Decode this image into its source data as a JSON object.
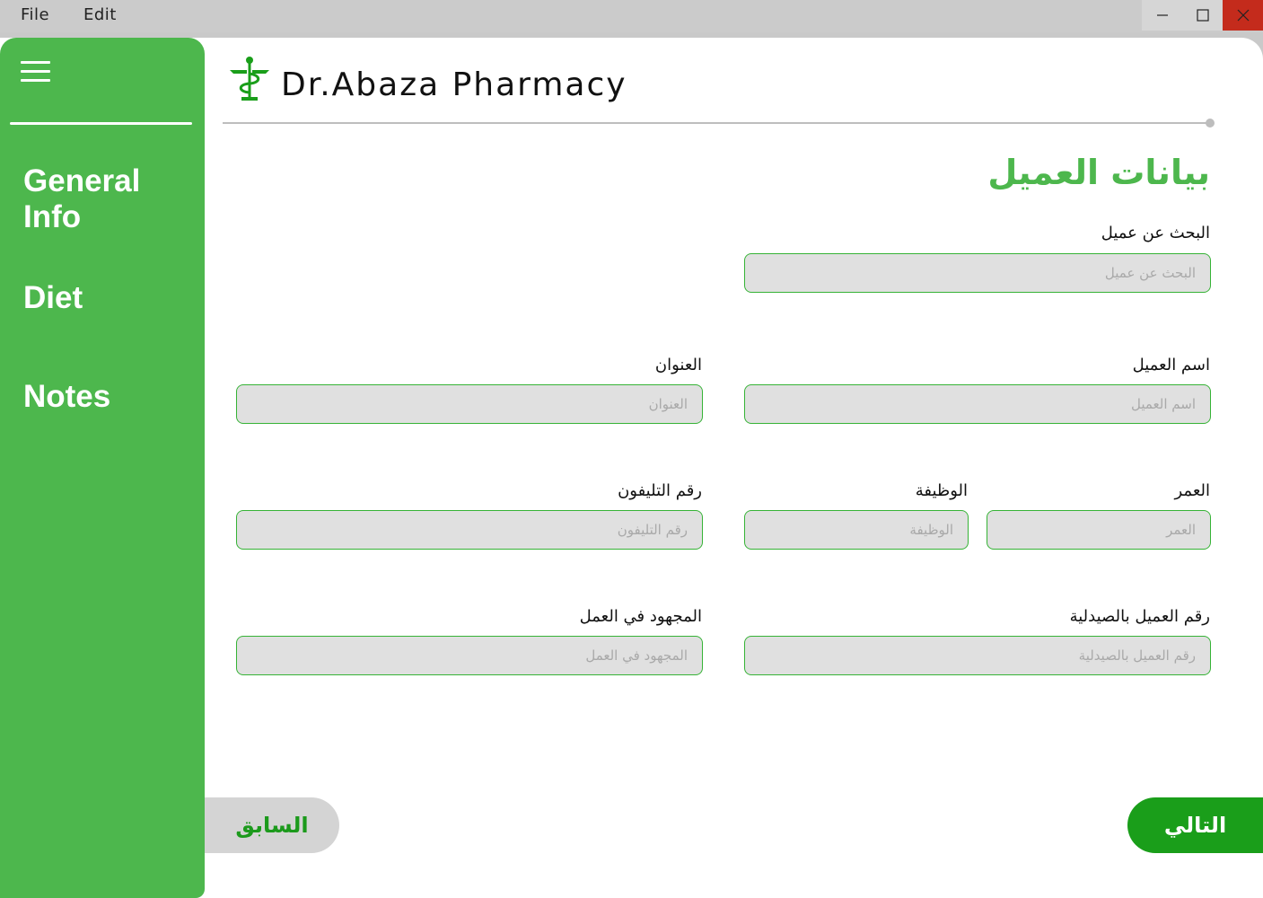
{
  "menubar": {
    "file": "File",
    "edit": "Edit"
  },
  "sidebar": {
    "items": [
      {
        "label": "General Info"
      },
      {
        "label": "Diet"
      },
      {
        "label": "Notes"
      }
    ]
  },
  "header": {
    "app_title": "Dr.Abaza Pharmacy",
    "logo_icon": "caduceus-icon"
  },
  "form": {
    "title": "بيانات العميل",
    "search": {
      "label": "البحث عن عميل",
      "placeholder": "البحث عن عميل",
      "value": ""
    },
    "name": {
      "label": "اسم العميل",
      "placeholder": "اسم العميل",
      "value": ""
    },
    "address": {
      "label": "العنوان",
      "placeholder": "العنوان",
      "value": ""
    },
    "age": {
      "label": "العمر",
      "placeholder": "العمر",
      "value": ""
    },
    "job": {
      "label": "الوظيفة",
      "placeholder": "الوظيفة",
      "value": ""
    },
    "phone": {
      "label": "رقم التليفون",
      "placeholder": "رقم التليفون",
      "value": ""
    },
    "client_number": {
      "label": "رقم العميل بالصيدلية",
      "placeholder": "رقم العميل بالصيدلية",
      "value": ""
    },
    "work_effort": {
      "label": "المجهود في العمل",
      "placeholder": "المجهود في العمل",
      "value": ""
    }
  },
  "buttons": {
    "prev": "السابق",
    "next": "التالي"
  },
  "colors": {
    "accent": "#4db74d",
    "accent_dark": "#1a9e1a",
    "input_bg": "#e0e0e0",
    "close": "#c42b1c"
  }
}
